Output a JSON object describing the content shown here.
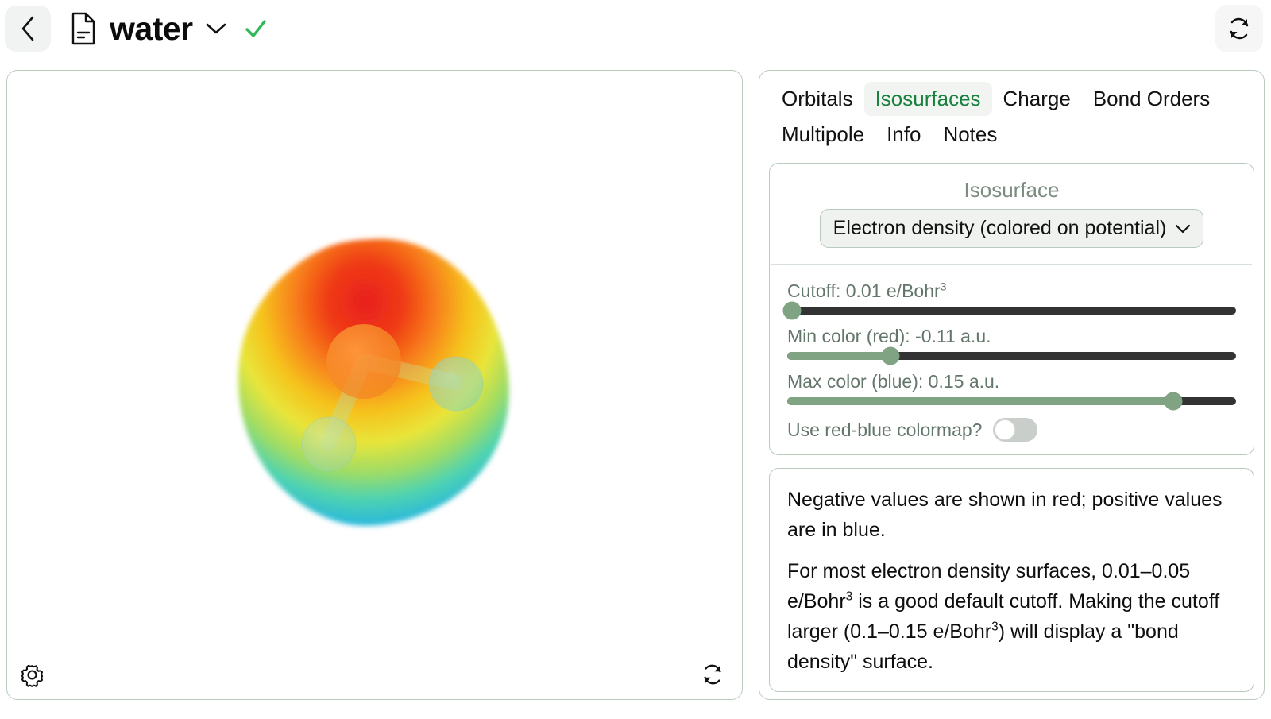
{
  "header": {
    "back_icon": "chevron-left-icon",
    "file_icon": "document-icon",
    "title": "water",
    "title_chevron_icon": "chevron-down-icon",
    "status_icon": "check-icon",
    "status_color": "#34b857",
    "refresh_icon": "refresh-icon"
  },
  "viewer": {
    "settings_icon": "gear-icon",
    "refresh_icon": "refresh-icon",
    "molecule": "water",
    "surface_description": "Electron density isosurface of water colored by electrostatic potential; red (negative) lobe near oxygen lone pairs, blue (positive) region near hydrogens"
  },
  "panel": {
    "tabs": [
      {
        "label": "Orbitals",
        "active": false
      },
      {
        "label": "Isosurfaces",
        "active": true
      },
      {
        "label": "Charge",
        "active": false
      },
      {
        "label": "Bond Orders",
        "active": false
      },
      {
        "label": "Multipole",
        "active": false
      },
      {
        "label": "Info",
        "active": false
      },
      {
        "label": "Notes",
        "active": false
      }
    ],
    "isosurface_card": {
      "title": "Isosurface",
      "select_value": "Electron density (colored on potential)",
      "select_chevron_icon": "chevron-down-icon",
      "sliders": [
        {
          "label": "Cutoff: 0.01 e/Bohr",
          "sup": "3",
          "percent": 1
        },
        {
          "label": "Min color (red): -0.11 a.u.",
          "sup": "",
          "percent": 23
        },
        {
          "label": "Max color (blue): 0.15 a.u.",
          "sup": "",
          "percent": 86
        }
      ],
      "toggle": {
        "label": "Use red-blue colormap?",
        "on": false
      }
    },
    "info_card": {
      "paragraph1": "Negative values are shown in red; positive values are in blue.",
      "paragraph2_a": "For most electron density surfaces, 0.01–0.05 e/Bohr",
      "paragraph2_sup1": "3",
      "paragraph2_b": " is a good default cutoff. Making the cutoff larger (0.1–0.15 e/Bohr",
      "paragraph2_sup2": "3",
      "paragraph2_c": ") will display a \"bond density\" surface."
    }
  },
  "colors": {
    "accent_green": "#17803d",
    "slider_green": "#7fa383",
    "track_dark": "#333333",
    "border_green": "#b9cbbc",
    "muted_text": "#63766a"
  }
}
